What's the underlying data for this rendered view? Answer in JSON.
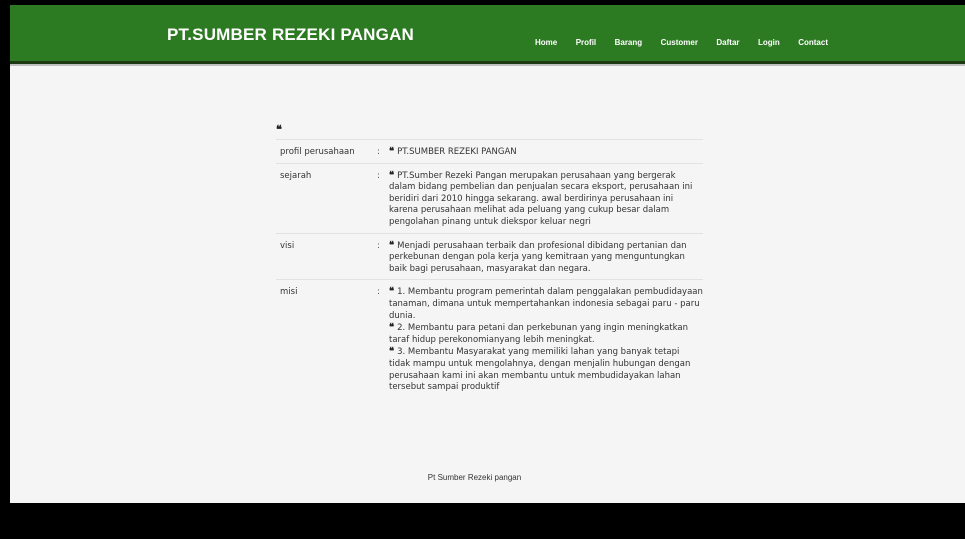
{
  "header": {
    "brand": "PT.SUMBER REZEKI PANGAN",
    "nav": [
      "Home",
      "Profil",
      "Barang",
      "Customer",
      "Daftar",
      "Login",
      "Contact"
    ]
  },
  "profile": {
    "lead_quote": "❝",
    "rows": [
      {
        "label": "profil perusahaan",
        "sep": ":",
        "lines": [
          {
            "quote": "❝",
            "text": "PT.SUMBER REZEKI PANGAN"
          }
        ]
      },
      {
        "label": "sejarah",
        "sep": ":",
        "lines": [
          {
            "quote": "❝",
            "text": "PT.Sumber Rezeki Pangan merupakan perusahaan yang bergerak dalam bidang pembelian dan penjualan secara eksport, perusahaan ini beridiri dari 2010 hingga sekarang. awal berdirinya perusahaan ini karena perusahaan melihat ada peluang yang cukup besar dalam pengolahan pinang untuk diekspor keluar negri"
          }
        ]
      },
      {
        "label": "visi",
        "sep": ":",
        "lines": [
          {
            "quote": "❝",
            "text": "Menjadi perusahaan terbaik dan profesional dibidang pertanian dan perkebunan dengan pola kerja yang kemitraan yang menguntungkan baik bagi perusahaan, masyarakat dan negara."
          }
        ]
      },
      {
        "label": "misi",
        "sep": ":",
        "lines": [
          {
            "quote": "❝",
            "text": "1. Membantu program pemerintah dalam penggalakan pembudidayaan tanaman, dimana untuk mempertahankan indonesia sebagai paru - paru dunia."
          },
          {
            "quote": "❝",
            "text": "2. Membantu para petani dan perkebunan yang ingin meningkatkan taraf hidup perekonomianyang lebih meningkat."
          },
          {
            "quote": "❝",
            "text": "3. Membantu Masyarakat yang memiliki lahan yang banyak tetapi tidak mampu untuk mengolahnya, dengan menjalin hubungan dengan perusahaan kami ini akan membantu untuk membudidayakan lahan tersebut sampai produktif"
          }
        ]
      }
    ]
  },
  "footer": {
    "text": "Pt Sumber Rezeki pangan"
  }
}
